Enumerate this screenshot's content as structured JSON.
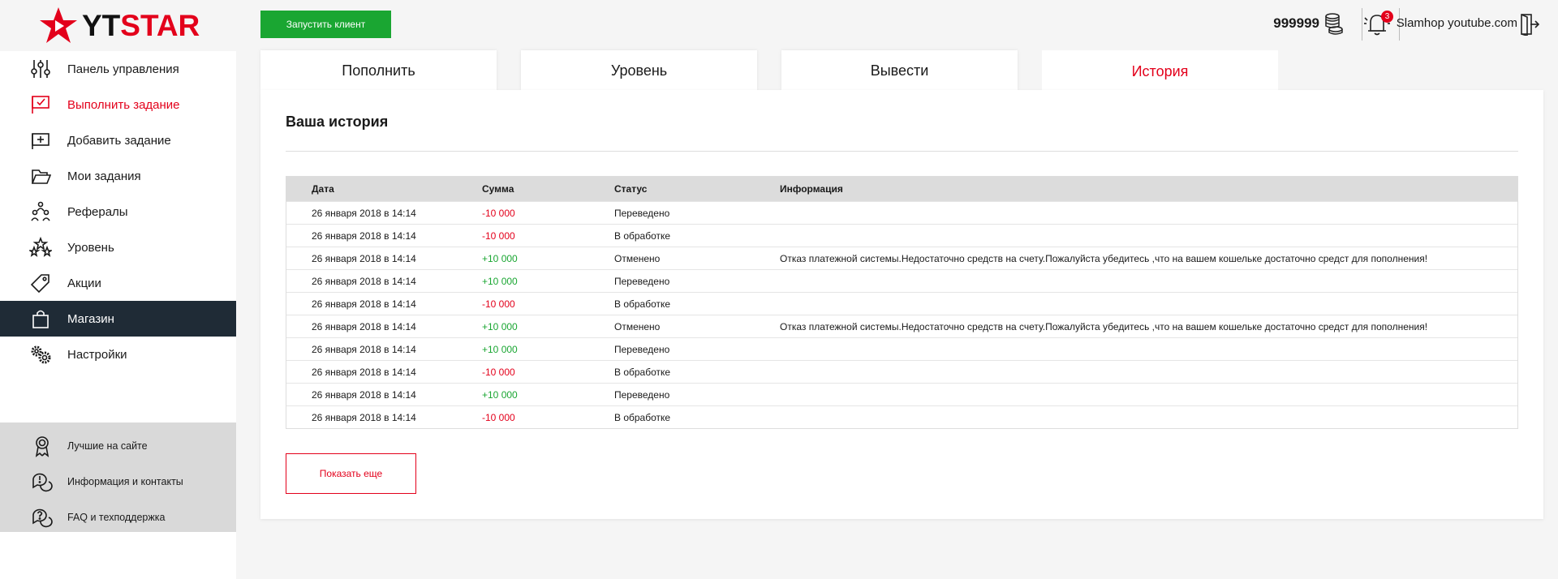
{
  "brand": {
    "part1": "YT",
    "part2": "STAR",
    "accent": "#e3001b"
  },
  "topbar": {
    "launch_label": "Запустить клиент",
    "balance": "999999",
    "notifications_count": "3",
    "username": "Slamhop youtube.com"
  },
  "sidebar": {
    "items": [
      {
        "label": "Панель управления",
        "icon": "sliders-icon"
      },
      {
        "label": "Выполнить задание",
        "icon": "flag-check-icon"
      },
      {
        "label": "Добавить задание",
        "icon": "flag-plus-icon"
      },
      {
        "label": "Мои задания",
        "icon": "folder-icon"
      },
      {
        "label": "Рефералы",
        "icon": "referrals-icon"
      },
      {
        "label": "Уровень",
        "icon": "stars-icon"
      },
      {
        "label": "Акции",
        "icon": "tag-icon"
      },
      {
        "label": "Магазин",
        "icon": "bag-icon"
      },
      {
        "label": "Настройки",
        "icon": "gears-icon"
      }
    ],
    "secondary": [
      {
        "label": "Лучшие на сайте",
        "icon": "award-icon"
      },
      {
        "label": "Информация и контакты",
        "icon": "chat-info-icon"
      },
      {
        "label": "FAQ и техподдержка",
        "icon": "chat-question-icon"
      }
    ]
  },
  "tabs": [
    "Пополнить",
    "Уровень",
    "Вывести",
    "История"
  ],
  "history": {
    "title": "Ваша история",
    "columns": [
      "Дата",
      "Сумма",
      "Статус",
      "Информация"
    ],
    "rows": [
      {
        "date": "26 января 2018 в 14:14",
        "sum": "-10 000",
        "status": "Переведено",
        "info": ""
      },
      {
        "date": "26 января 2018 в 14:14",
        "sum": "-10 000",
        "status": "В обработке",
        "info": ""
      },
      {
        "date": "26 января 2018 в 14:14",
        "sum": "+10 000",
        "status": "Отменено",
        "info": "Отказ платежной системы.Недостаточно средств на счету.Пожалуйста убедитесь ,что на вашем кошельке достаточно средст для пополнения!"
      },
      {
        "date": "26 января 2018 в 14:14",
        "sum": "+10 000",
        "status": "Переведено",
        "info": ""
      },
      {
        "date": "26 января 2018 в 14:14",
        "sum": "-10 000",
        "status": "В обработке",
        "info": ""
      },
      {
        "date": "26 января 2018 в 14:14",
        "sum": "+10 000",
        "status": "Отменено",
        "info": "Отказ платежной системы.Недостаточно средств на счету.Пожалуйста убедитесь ,что на вашем кошельке достаточно средст для пополнения!"
      },
      {
        "date": "26 января 2018 в 14:14",
        "sum": "+10 000",
        "status": "Переведено",
        "info": ""
      },
      {
        "date": "26 января 2018 в 14:14",
        "sum": "-10 000",
        "status": "В обработке",
        "info": ""
      },
      {
        "date": "26 января 2018 в 14:14",
        "sum": "+10 000",
        "status": "Переведено",
        "info": ""
      },
      {
        "date": "26 января 2018 в 14:14",
        "sum": "-10 000",
        "status": "В обработке",
        "info": ""
      }
    ],
    "more_label": "Показать еще"
  }
}
